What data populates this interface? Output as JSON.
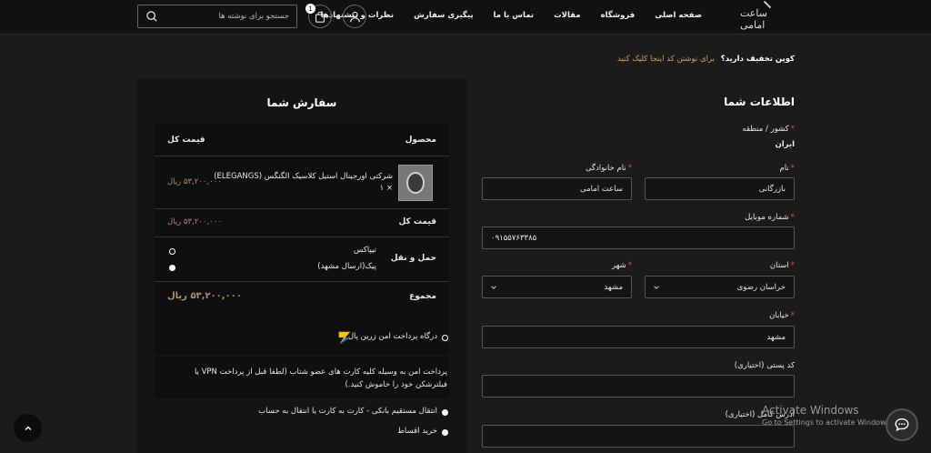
{
  "header": {
    "logo_text": "ساعت امامی",
    "nav": [
      "صفحه اصلی",
      "فروشگاه",
      "مقالات",
      "تماس با ما",
      "پیگیری سفارش",
      "نظرات و پیشنهادها"
    ],
    "cart_count": "1",
    "search_placeholder": "جستجو برای نوشته ها"
  },
  "coupon": {
    "question": "کوپن تخفیف دارید؟",
    "link": "برای نوشتن کد اینجا کلیک کنید"
  },
  "order": {
    "title": "سفارش شما",
    "col_product": "محصول",
    "col_total": "قیمت کل",
    "item_name": "شرکتی اورجینال استیل کلاسیک الگنگس (ELEGANGS)",
    "item_qty": "× ۱",
    "item_price": "۵۳,۲۰۰,۰۰۰ ریال",
    "subtotal_label": "قیمت کل",
    "subtotal_value": "۵۳,۲۰۰,۰۰۰ ریال",
    "shipping_label": "حمل و نقل",
    "shipping_options": [
      "تیپاکس",
      "پیک(ارسال مشهد)"
    ],
    "total_label": "مجموع",
    "total_value": "۵۳,۲۰۰,۰۰۰ ریال",
    "payment_gateway": "درگاه پرداخت امن زرین پال",
    "payment_desc": "پرداخت امن به وسیله کلیه کارت های عضو شتاب (لطفا قبل از پرداخت VPN یا فیلترشکن خود را خاموش کنید.)",
    "payment_transfer": "انتقال مستقیم بانکی - کارت به کارت یا انتقال به حساب",
    "payment_installment": "خرید اقساط"
  },
  "billing": {
    "title": "اطلاعات شما",
    "country_label": "کشور / منطقه",
    "country_value": "ایران",
    "first_name_label": "نام",
    "first_name_value": "بازرگانی",
    "last_name_label": "نام خانوادگی",
    "last_name_value": "ساعت امامی",
    "mobile_label": "شماره موبایل",
    "mobile_value": "۰۹۱۵۵۷۶۳۳۸۵",
    "state_label": "استان",
    "state_value": "خراسان رضوی",
    "city_label": "شهر",
    "city_value": "مشهد",
    "street_label": "خیابان",
    "street_value": "مشهد",
    "postcode_label": "کد پستی",
    "postcode_optional": "(اختیاری)",
    "address_label": "آدرس کامل",
    "address_optional": "(اختیاری)"
  },
  "watermark": {
    "line1": "Activate Windows",
    "line2": "Go to Settings to activate Windows."
  },
  "colors": {
    "background": "#1b1b1b",
    "accent_gold": "#c9a76a",
    "required_red": "#e05050"
  }
}
